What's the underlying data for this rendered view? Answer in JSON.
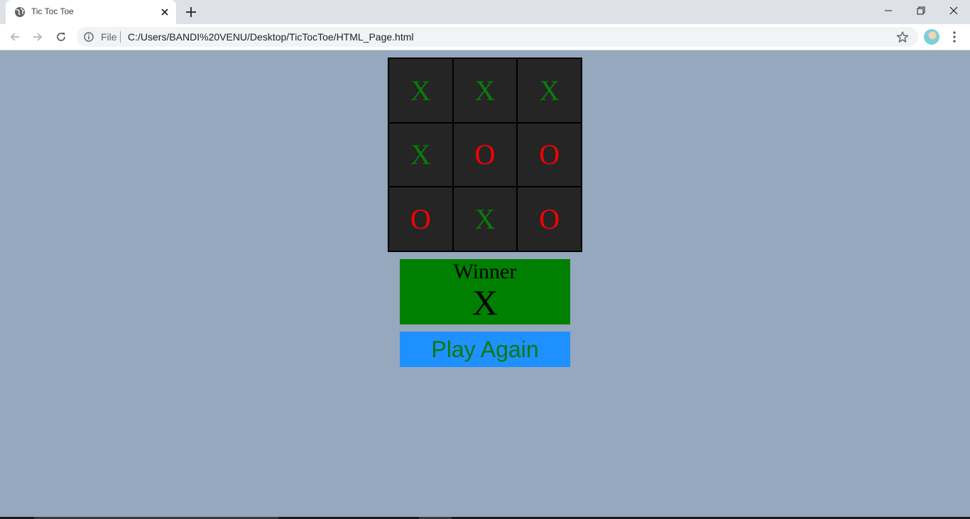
{
  "browser": {
    "tab": {
      "title": "Tic Toc Toe"
    },
    "omnibox": {
      "scheme_label": "File",
      "url": "C:/Users/BANDI%20VENU/Desktop/TicTocToe/HTML_Page.html"
    }
  },
  "game": {
    "board": [
      [
        "X",
        "X",
        "X"
      ],
      [
        "X",
        "O",
        "O"
      ],
      [
        "O",
        "X",
        "O"
      ]
    ],
    "colors": {
      "x": "#0b7a0b",
      "o": "#ff0000",
      "board_background": "#252525",
      "page_background": "#95a8bd"
    },
    "winner": {
      "label": "Winner",
      "value": "X",
      "background": "#008000"
    },
    "play_again": {
      "label": "Play Again",
      "background": "#1e90ff"
    }
  },
  "icons": {
    "tab_favicon": "globe-icon",
    "tab_close": "close-icon",
    "new_tab": "plus-icon",
    "minimize": "minimize-icon",
    "restore": "restore-icon",
    "close_window": "close-icon",
    "back": "back-arrow-icon",
    "forward": "forward-arrow-icon",
    "reload": "reload-icon",
    "info": "info-icon",
    "bookmark": "star-icon",
    "menu": "kebab-menu-icon"
  }
}
